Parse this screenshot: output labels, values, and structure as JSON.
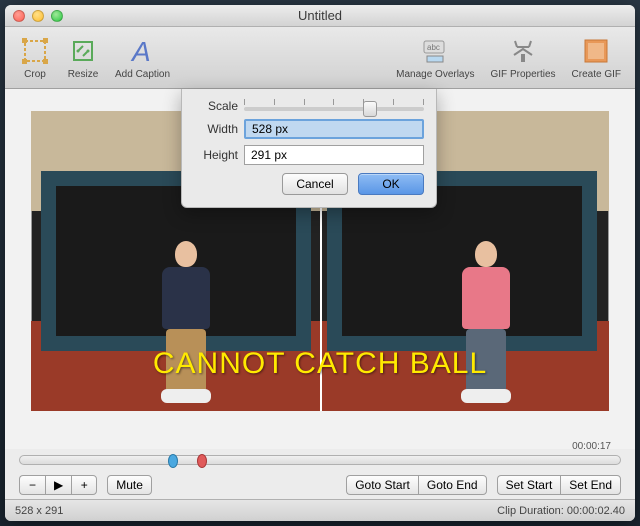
{
  "window": {
    "title": "Untitled"
  },
  "toolbar": {
    "crop": "Crop",
    "resize": "Resize",
    "addCaption": "Add Caption",
    "manageOverlays": "Manage Overlays",
    "gifProperties": "GIF Properties",
    "createGif": "Create GIF"
  },
  "preview": {
    "caption": "CANNOT CATCH BALL"
  },
  "popup": {
    "scale_label": "Scale",
    "width_label": "Width",
    "height_label": "Height",
    "width_value": "528 px",
    "height_value": "291 px",
    "slider_percent": 70,
    "cancel": "Cancel",
    "ok": "OK"
  },
  "timeline": {
    "duration_display": "00:00:17"
  },
  "controls": {
    "minus": "−",
    "play": "▶",
    "plus": "+",
    "mute": "Mute",
    "goto_start": "Goto Start",
    "goto_end": "Goto End",
    "set_start": "Set Start",
    "set_end": "Set End"
  },
  "status": {
    "dimensions": "528 x 291",
    "clip_duration_label": "Clip Duration:",
    "clip_duration_value": "00:00:02.40"
  }
}
